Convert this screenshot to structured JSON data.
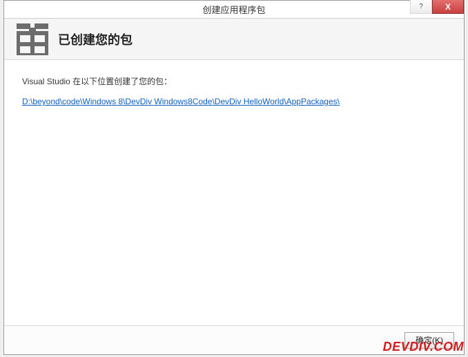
{
  "dialog": {
    "title": "创建应用程序包",
    "header_text": "已创建您的包",
    "message": "Visual Studio 在以下位置创建了您的包：",
    "path_link": "D:\\beyond\\code\\Windows 8\\DevDiv Windows8Code\\DevDiv HelloWorld\\AppPackages\\",
    "ok_label": "确定(K)"
  },
  "window_controls": {
    "help_tooltip": "?",
    "close_tooltip": "X"
  },
  "watermark": "DEVDIV.COM"
}
